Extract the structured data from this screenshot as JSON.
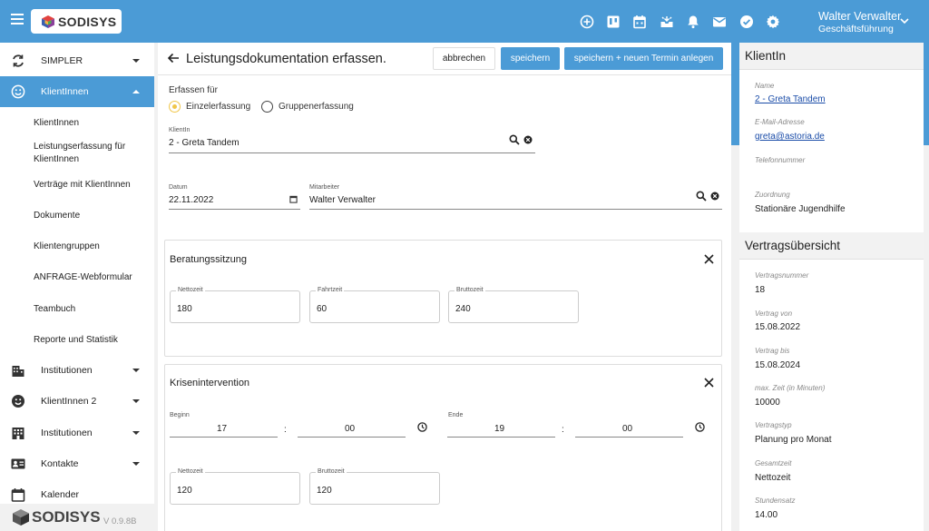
{
  "header": {
    "logo_text": "SODISYS",
    "user_name": "Walter Verwalter",
    "user_role": "Geschäftsführung",
    "icons": [
      "add-circle-icon",
      "board-icon",
      "calendar-icon",
      "inbox-icon",
      "bell-icon",
      "mail-icon",
      "check-circle-icon",
      "gear-icon"
    ]
  },
  "sidebar": {
    "items": [
      {
        "label": "SIMPLER",
        "icon": "sync-icon"
      },
      {
        "label": "KlientInnen",
        "icon": "smiley-icon",
        "active": true
      },
      {
        "label": "Institutionen",
        "icon": "building-icon"
      },
      {
        "label": "KlientInnen 2",
        "icon": "smiley-filled-icon"
      },
      {
        "label": "Institutionen",
        "icon": "building-grid-icon"
      },
      {
        "label": "Kontakte",
        "icon": "contact-card-icon"
      },
      {
        "label": "Kalender",
        "icon": "calendar-icon"
      }
    ],
    "sub_items": [
      "KlientInnen",
      "Leistungserfassung für KlientInnen",
      "Verträge mit KlientInnen",
      "Dokumente",
      "Klientengruppen",
      "ANFRAGE-Webformular",
      "Teambuch",
      "Reporte und Statistik"
    ],
    "footer_logo": "SODISYS",
    "version": "V 0.9.8B"
  },
  "main": {
    "title": "Leistungsdokumentation erfassen.",
    "buttons": {
      "cancel": "abbrechen",
      "save": "speichern",
      "save_new": "speichern + neuen Termin anlegen"
    },
    "erfassen_label": "Erfassen für",
    "radio_single": "Einzelerfassung",
    "radio_group": "Gruppenerfassung",
    "klient_label": "KlientIn",
    "klient_value": "2 - Greta Tandem",
    "datum_label": "Datum",
    "datum_value": "22.11.2022",
    "mitarbeiter_label": "Mitarbeiter",
    "mitarbeiter_value": "Walter Verwalter",
    "card1": {
      "title": "Beratungssitzung",
      "netto_label": "Nettozeit",
      "netto": "180",
      "fahrt_label": "Fahrtzeit",
      "fahrt": "60",
      "brutto_label": "Bruttozeit",
      "brutto": "240"
    },
    "card2": {
      "title": "Krisenintervention",
      "beginn_label": "Beginn",
      "beginn_h": "17",
      "beginn_m": "00",
      "ende_label": "Ende",
      "ende_h": "19",
      "ende_m": "00",
      "colon": ":",
      "netto_label": "Nettozeit",
      "netto": "120",
      "brutto_label": "Bruttozeit",
      "brutto": "120"
    }
  },
  "klient_panel": {
    "title": "KlientIn",
    "name_label": "Name",
    "name": "2 - Greta Tandem",
    "email_label": "E-Mail-Adresse",
    "email": "greta@astoria.de",
    "phone_label": "Telefonnummer",
    "phone": "",
    "zuordnung_label": "Zuordnung",
    "zuordnung": "Stationäre Jugendhilfe"
  },
  "vertrag_panel": {
    "title": "Vertragsübersicht",
    "rows": [
      {
        "label": "Vertragsnummer",
        "value": "18"
      },
      {
        "label": "Vertrag von",
        "value": "15.08.2022"
      },
      {
        "label": "Vertrag bis",
        "value": "15.08.2024"
      },
      {
        "label": "max. Zeit (in Minuten)",
        "value": "10000"
      },
      {
        "label": "Vertragstyp",
        "value": "Planung pro Monat"
      },
      {
        "label": "Gesamtzeit",
        "value": "Nettozeit"
      },
      {
        "label": "Stundensatz",
        "value": "14.00"
      }
    ]
  },
  "colors": {
    "accent": "#4b9bd6",
    "radio_active": "#f0c64a",
    "link": "#1a4ca8"
  }
}
